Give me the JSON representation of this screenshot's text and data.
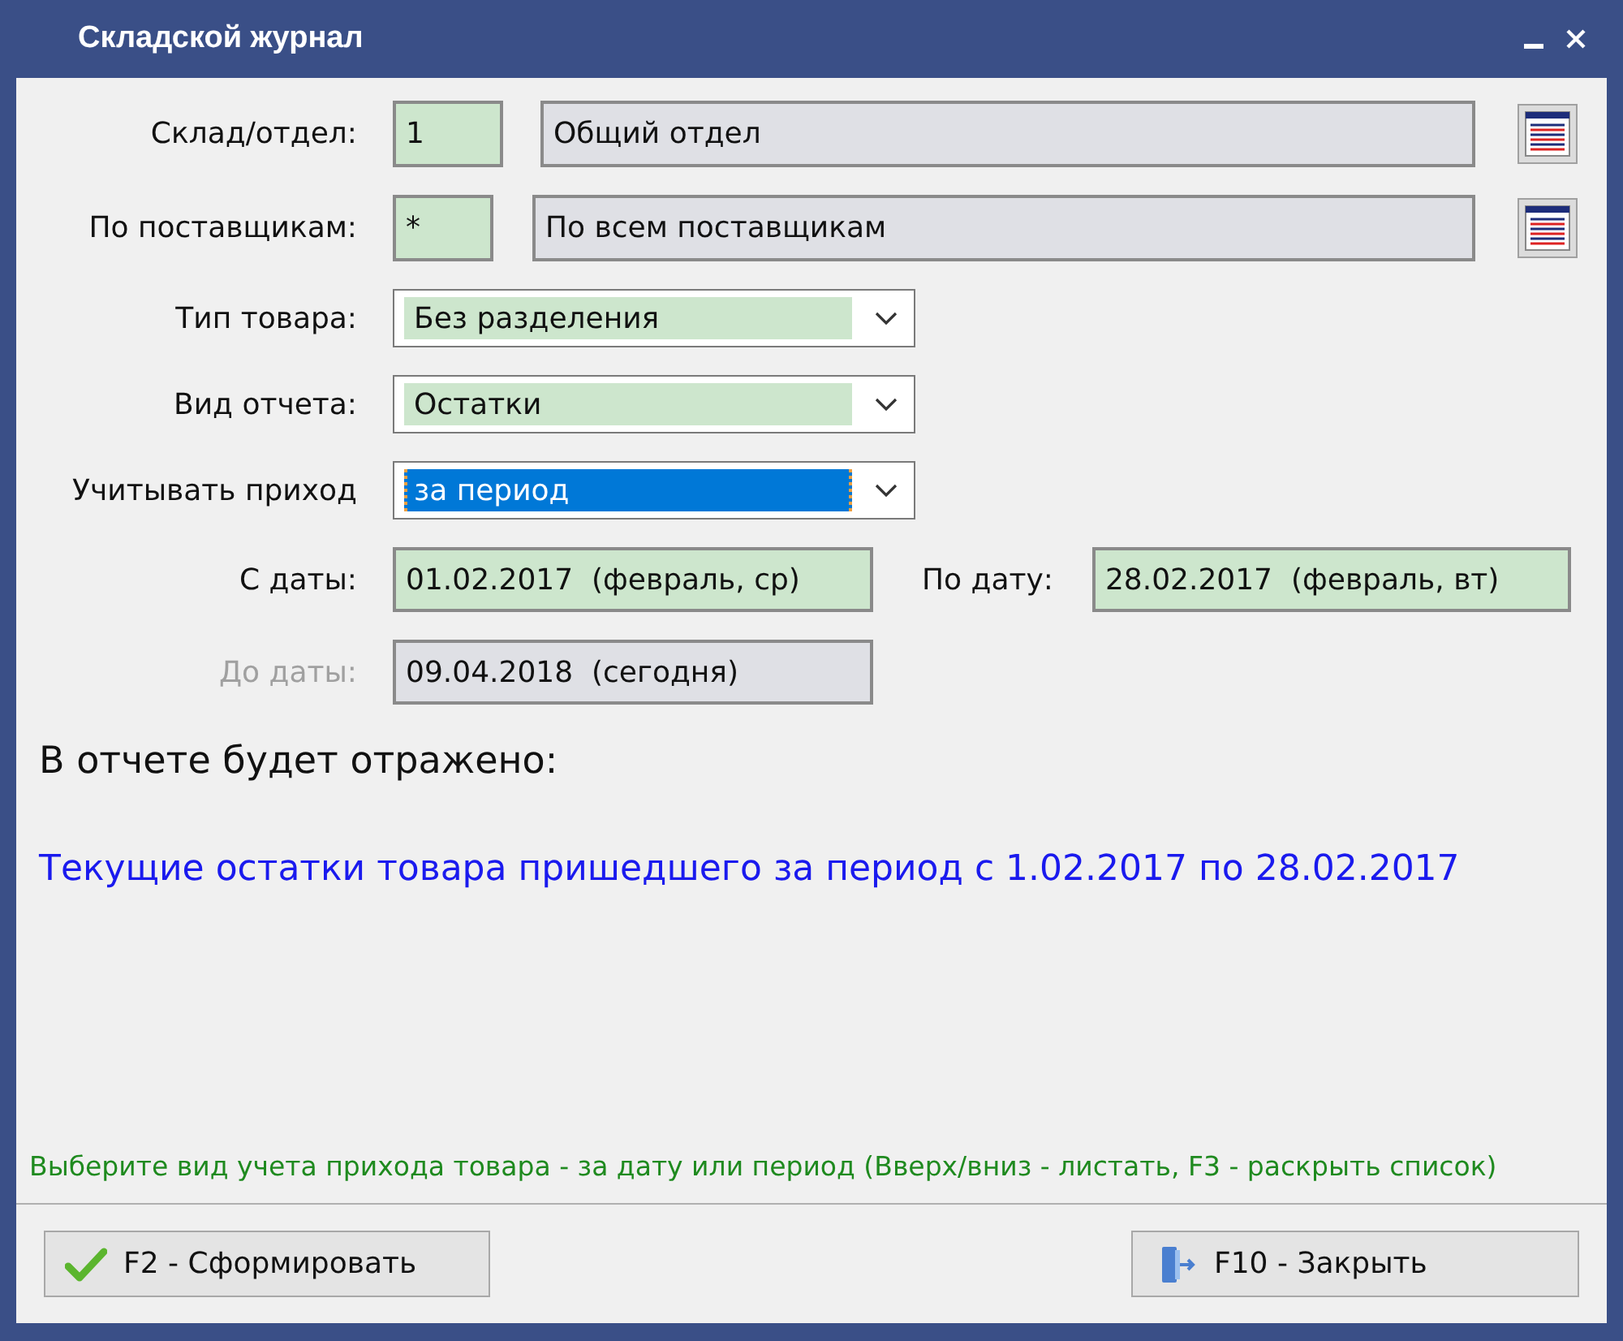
{
  "window": {
    "title": "Складской журнал"
  },
  "fields": [
    {
      "kind": "lookup",
      "label": "Склад/отдел:",
      "code": "1",
      "value": "Общий отдел"
    },
    {
      "kind": "lookup",
      "label": "По поставщикам:",
      "code": "*",
      "value": "По всем поставщикам"
    },
    {
      "kind": "combo",
      "label": "Тип товара:",
      "value": "Без разделения",
      "focused": false
    },
    {
      "kind": "combo",
      "label": "Вид отчета:",
      "value": "Остатки",
      "focused": false
    },
    {
      "kind": "combo",
      "label": "Учитывать приход",
      "value": "за период",
      "focused": true
    },
    {
      "kind": "daterange",
      "label": "С даты:",
      "value": "01.02.2017  (февраль, ср)",
      "label_2": "По дату:",
      "value_2": "28.02.2017  (февраль, вт)",
      "disabled": false
    },
    {
      "kind": "date",
      "label": "До даты:",
      "value": "09.04.2018  (сегодня)",
      "disabled": true
    }
  ],
  "summary": {
    "heading": "В отчете будет отражено:",
    "text": "Текущие остатки товара пришедшего за период с 1.02.2017 по 28.02.2017"
  },
  "hint": "Выберите вид учета прихода товара - за дату или период (Вверх/вниз - листать, F3 - раскрыть список)",
  "buttons": [
    {
      "kind": "ok",
      "label": "F2 - Сформировать"
    },
    {
      "kind": "close",
      "label": "F10 - Закрыть"
    }
  ]
}
